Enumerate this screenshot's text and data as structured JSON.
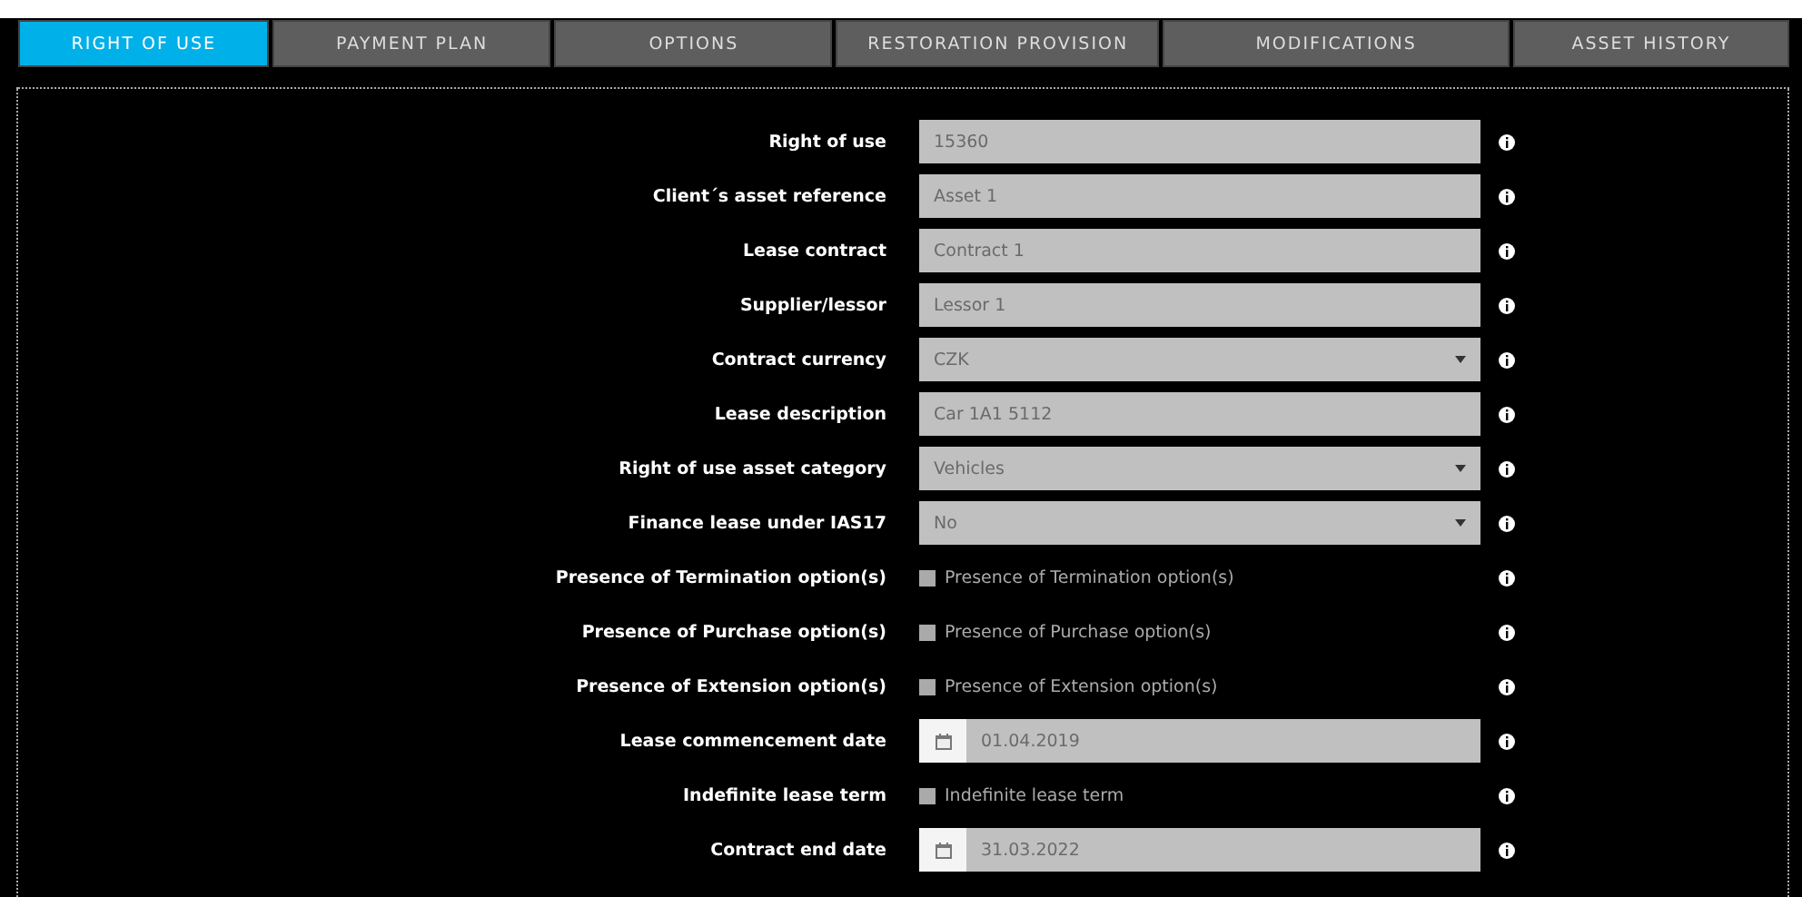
{
  "tabs": [
    {
      "label": "RIGHT OF USE",
      "selected": true
    },
    {
      "label": "PAYMENT PLAN",
      "selected": false
    },
    {
      "label": "OPTIONS",
      "selected": false
    },
    {
      "label": "RESTORATION PROVISION",
      "selected": false
    },
    {
      "label": "MODIFICATIONS",
      "selected": false
    },
    {
      "label": "ASSET HISTORY",
      "selected": false
    }
  ],
  "fields": [
    {
      "label": "Right of use",
      "kind": "text",
      "value": "15360"
    },
    {
      "label": "Client´s asset reference",
      "kind": "text",
      "value": "Asset 1"
    },
    {
      "label": "Lease contract",
      "kind": "text",
      "value": "Contract 1"
    },
    {
      "label": "Supplier/lessor",
      "kind": "text",
      "value": "Lessor 1"
    },
    {
      "label": "Contract currency",
      "kind": "select",
      "value": "CZK"
    },
    {
      "label": "Lease description",
      "kind": "text",
      "value": "Car 1A1 5112"
    },
    {
      "label": "Right of use asset category",
      "kind": "select",
      "value": "Vehicles"
    },
    {
      "label": "Finance lease under IAS17",
      "kind": "select",
      "value": "No"
    },
    {
      "label": "Presence of Termination option(s)",
      "kind": "checkbox",
      "value": "Presence of Termination option(s)",
      "checked": false
    },
    {
      "label": "Presence of Purchase option(s)",
      "kind": "checkbox",
      "value": "Presence of Purchase option(s)",
      "checked": false
    },
    {
      "label": "Presence of Extension option(s)",
      "kind": "checkbox",
      "value": "Presence of Extension option(s)",
      "checked": false
    },
    {
      "label": "Lease commencement date",
      "kind": "date",
      "value": "01.04.2019"
    },
    {
      "label": "Indefinite lease term",
      "kind": "checkbox",
      "value": "Indefinite lease term",
      "checked": false
    },
    {
      "label": "Contract end date",
      "kind": "date",
      "value": "31.03.2022"
    }
  ]
}
